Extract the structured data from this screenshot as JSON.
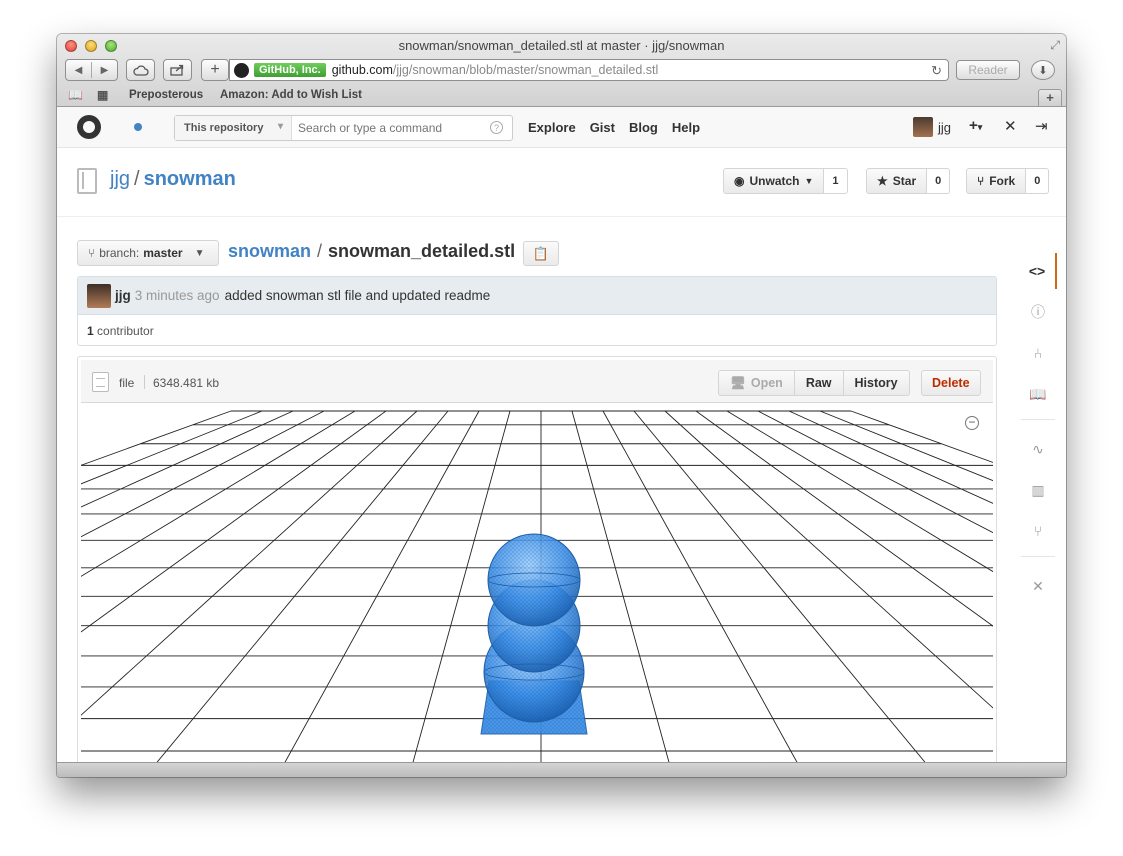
{
  "window": {
    "title": "snowman/snowman_detailed.stl at master · jjg/snowman"
  },
  "browser": {
    "ev_badge": "GitHub, Inc.",
    "url_host": "github.com",
    "url_path": "/jjg/snowman/blob/master/snowman_detailed.stl",
    "reader_label": "Reader",
    "bookmarks": [
      "Preposterous",
      "Amazon: Add to Wish List"
    ]
  },
  "gh_header": {
    "search_scope": "This repository",
    "search_placeholder": "Search or type a command",
    "nav": [
      "Explore",
      "Gist",
      "Blog",
      "Help"
    ],
    "username": "jjg"
  },
  "repo": {
    "owner": "jjg",
    "name": "snowman",
    "watch_label": "Unwatch",
    "watch_count": "1",
    "star_label": "Star",
    "star_count": "0",
    "fork_label": "Fork",
    "fork_count": "0"
  },
  "file_nav": {
    "branch_prefix": "branch:",
    "branch": "master",
    "root": "snowman",
    "file": "snowman_detailed.stl"
  },
  "commit": {
    "author": "jjg",
    "time": "3 minutes ago",
    "message": "added snowman stl file and updated readme",
    "contributor_count": "1",
    "contributor_label": "contributor"
  },
  "file": {
    "kind": "file",
    "size": "6348.481 kb",
    "actions": [
      "Open",
      "Raw",
      "History"
    ],
    "delete_label": "Delete"
  },
  "colors": {
    "link": "#4183c4",
    "delete": "#bd2c00",
    "active_tab": "#d26911",
    "model": "#3a8ee8"
  },
  "sidebar_icons": [
    "code-icon",
    "issues-icon",
    "pull-request-icon",
    "wiki-icon",
    "pulse-icon",
    "graphs-icon",
    "network-icon",
    "settings-icon"
  ]
}
